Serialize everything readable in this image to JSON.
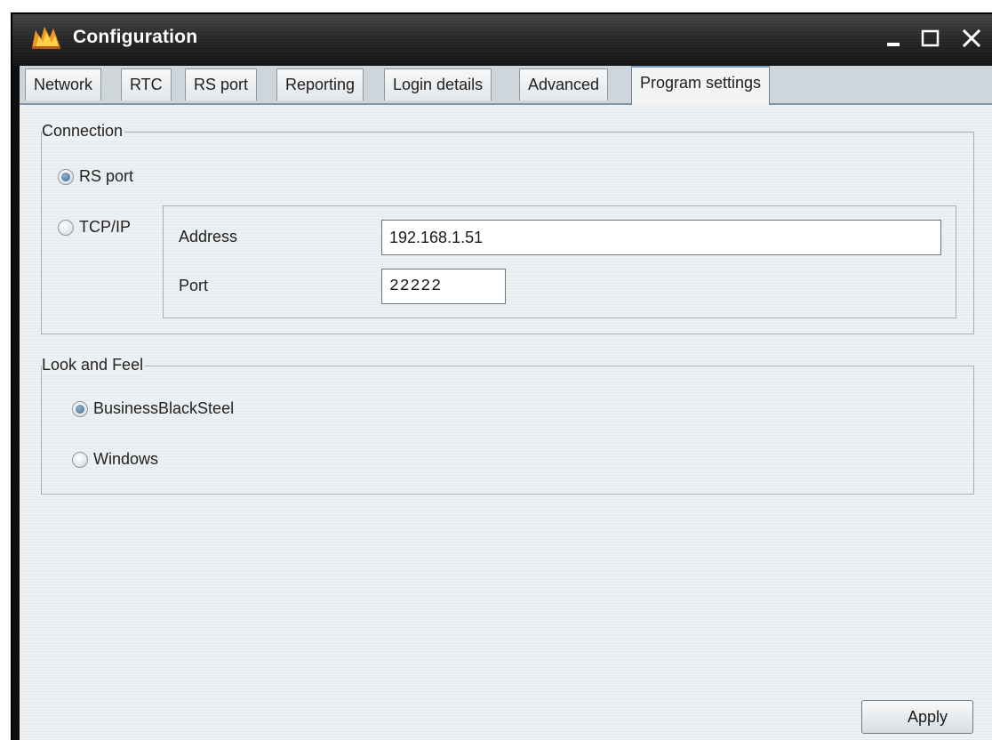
{
  "window": {
    "title": "Configuration",
    "controls": {
      "minimize": "minimize-icon",
      "maximize": "maximize-icon",
      "close": "close-icon"
    }
  },
  "tabs": [
    {
      "label": "Network",
      "active": false
    },
    {
      "label": "RTC",
      "active": false
    },
    {
      "label": "RS port",
      "active": false
    },
    {
      "label": "Reporting",
      "active": false
    },
    {
      "label": "Login details",
      "active": false
    },
    {
      "label": "Advanced",
      "active": false
    },
    {
      "label": "Program settings",
      "active": true
    }
  ],
  "connection": {
    "legend": "Connection",
    "rs_port": {
      "label": "RS port",
      "checked": true
    },
    "tcp_ip": {
      "label": "TCP/IP",
      "checked": false
    },
    "address": {
      "label": "Address",
      "value": "192.168.1.51"
    },
    "port": {
      "label": "Port",
      "value": "22222"
    }
  },
  "look_and_feel": {
    "legend": "Look and Feel",
    "options": [
      {
        "label": "BusinessBlackSteel",
        "checked": true
      },
      {
        "label": "Windows",
        "checked": false
      }
    ]
  },
  "apply_label": "Apply",
  "colors": {
    "titlebar": "#1e1e1e",
    "active_tab_accent": "#7aa0c0",
    "radio_fill": "#3c6a91"
  }
}
